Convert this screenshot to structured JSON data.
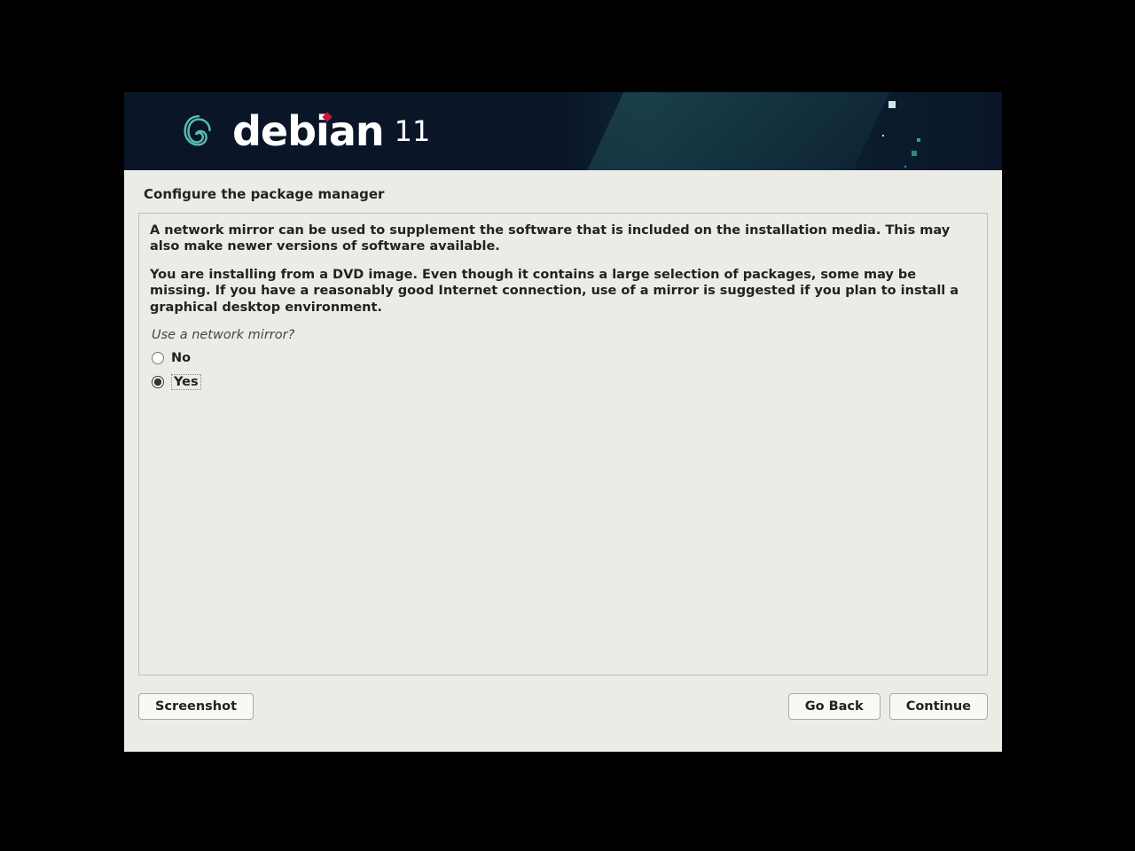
{
  "header": {
    "brand": "debian",
    "version": "11"
  },
  "page": {
    "title": "Configure the package manager",
    "paragraphs": [
      "A network mirror can be used to supplement the software that is included on the installation media. This may also make newer versions of software available.",
      "You are installing from a DVD image. Even though it contains a large selection of packages, some may be missing. If you have a reasonably good Internet connection, use of a mirror is suggested if you plan to install a graphical desktop environment."
    ],
    "question": "Use a network mirror?",
    "options": [
      {
        "label": "No",
        "selected": false
      },
      {
        "label": "Yes",
        "selected": true
      }
    ]
  },
  "buttons": {
    "screenshot": "Screenshot",
    "go_back": "Go Back",
    "continue": "Continue"
  }
}
